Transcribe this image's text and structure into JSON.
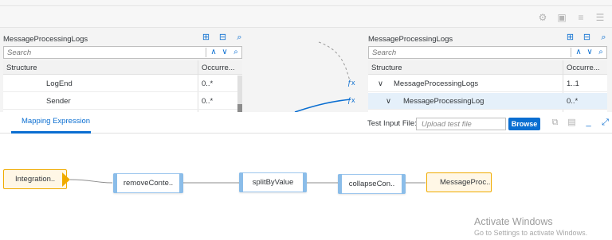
{
  "left_pane": {
    "title": "MessageProcessingLogs",
    "search_placeholder": "Search",
    "col_structure": "Structure",
    "col_occurrence": "Occurre...",
    "rows": [
      {
        "name": "LogEnd",
        "occurrence": "0..*"
      },
      {
        "name": "Sender",
        "occurrence": "0..*"
      }
    ]
  },
  "right_pane": {
    "title": "MessageProcessingLogs",
    "search_placeholder": "Search",
    "col_structure": "Structure",
    "col_occurrence": "Occurre...",
    "rows": [
      {
        "name": "MessageProcessingLogs",
        "occurrence": "1..1"
      },
      {
        "name": "MessageProcessingLog",
        "occurrence": "0..*"
      }
    ]
  },
  "tab": {
    "label": "Mapping Expression",
    "test_input_label": "Test Input File:",
    "test_input_placeholder": "Upload test file",
    "browse_label": "Browse"
  },
  "flow": {
    "source": "Integration..",
    "functions": [
      "removeConte..",
      "splitByValue",
      "collapseCon.."
    ],
    "target": "MessageProc.."
  },
  "watermark": {
    "line1": "Activate Windows",
    "line2": "Go to Settings to activate Windows."
  },
  "colors": {
    "accent": "#0a6ed1",
    "node_border": "#9ec7ee",
    "source_target": "#f0ab00"
  }
}
